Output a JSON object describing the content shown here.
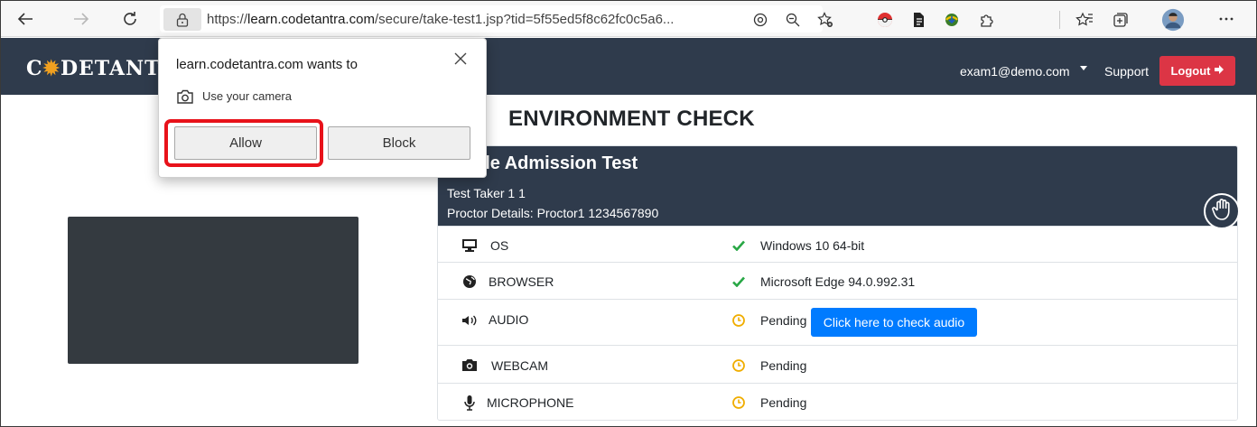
{
  "browser": {
    "url_prefix": "https://",
    "url_host": "learn.codetantra.com",
    "url_path": "/secure/take-test1.jsp?tid=5f55ed5f8c62fc0c5a6..."
  },
  "site": {
    "logo_text": "C",
    "logo_gear": "✹",
    "logo_rest": "DETANT",
    "user_email": "exam1@demo.com",
    "support_label": "Support",
    "logout_label": "Logout",
    "logout_icon": "⇨"
  },
  "page": {
    "title": "ENVIRONMENT CHECK"
  },
  "test": {
    "name": "ple Admission Test",
    "taker": "Test Taker 1 1",
    "proctor": "Proctor Details: Proctor1 1234567890"
  },
  "checks": [
    {
      "label": "OS",
      "status": "ok",
      "value": "Windows 10 64-bit",
      "icon": "monitor-icon"
    },
    {
      "label": "BROWSER",
      "status": "ok",
      "value": "Microsoft Edge 94.0.992.31",
      "icon": "globe-icon"
    },
    {
      "label": "AUDIO",
      "status": "pending",
      "value": "Pending",
      "icon": "speaker-icon",
      "action": "Click here to check audio"
    },
    {
      "label": "WEBCAM",
      "status": "pending",
      "value": "Pending",
      "icon": "camera-icon"
    },
    {
      "label": "MICROPHONE",
      "status": "pending",
      "value": "Pending",
      "icon": "microphone-icon"
    }
  ],
  "popup": {
    "title": "learn.codetantra.com wants to",
    "permission": "Use your camera",
    "allow_label": "Allow",
    "block_label": "Block"
  },
  "colors": {
    "navbar": "#2f3b4c",
    "logout": "#dc3545",
    "ok": "#28a745",
    "pending": "#f0ad00",
    "primary": "#007bff",
    "highlight": "#e8121a"
  }
}
